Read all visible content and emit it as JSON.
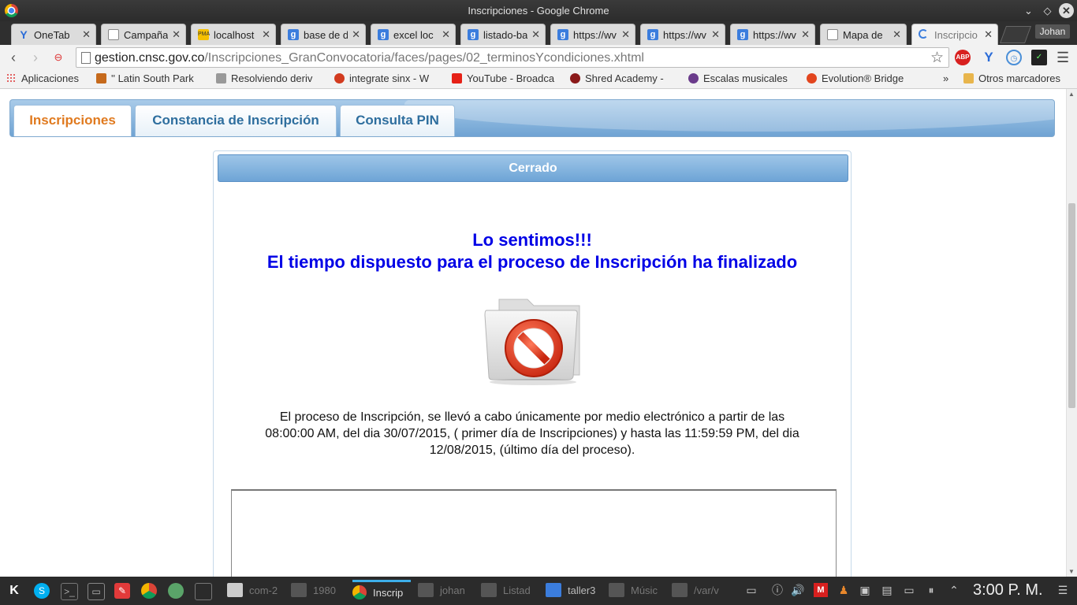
{
  "window": {
    "title": "Inscripciones - Google Chrome",
    "controls": [
      "minimize",
      "restore",
      "close"
    ]
  },
  "tabs": [
    {
      "label": "OneTab",
      "icon": "onetab-icon"
    },
    {
      "label": "Campaña",
      "icon": "document-icon"
    },
    {
      "label": "localhost",
      "icon": "phpmyadmin-icon"
    },
    {
      "label": "base de d",
      "icon": "google-icon"
    },
    {
      "label": "excel loc",
      "icon": "google-icon"
    },
    {
      "label": "listado-ba",
      "icon": "google-icon"
    },
    {
      "label": "https://wv",
      "icon": "google-icon"
    },
    {
      "label": "https://wv",
      "icon": "google-icon"
    },
    {
      "label": "https://wv",
      "icon": "google-icon"
    },
    {
      "label": "Mapa de",
      "icon": "document-icon"
    },
    {
      "label": "Inscripcio",
      "icon": "loading-icon",
      "active": true
    }
  ],
  "profile": {
    "name": "Johan"
  },
  "address_bar": {
    "host": "gestion.cnsc.gov.co",
    "path": "/Inscripciones_GranConvocatoria/faces/pages/02_terminosYcondiciones.xhtml"
  },
  "extensions": [
    "adblock-plus-icon",
    "yoroi-icon",
    "timer-icon",
    "todo-check-icon"
  ],
  "bookmarks": [
    {
      "label": "Aplicaciones",
      "icon": "apps-icon"
    },
    {
      "label": "'' Latin South Park",
      "icon": "bookmark-icon"
    },
    {
      "label": "Resolviendo deriv",
      "icon": "bookmark-icon"
    },
    {
      "label": "integrate sinx - W",
      "icon": "bookmark-icon"
    },
    {
      "label": "YouTube - Broadca",
      "icon": "youtube-icon"
    },
    {
      "label": "Shred Academy -",
      "icon": "bookmark-icon"
    },
    {
      "label": "Escalas musicales",
      "icon": "bookmark-icon"
    },
    {
      "label": "Evolution® Bridge",
      "icon": "bookmark-icon"
    },
    {
      "label": "»",
      "icon": ""
    },
    {
      "label": "Otros marcadores",
      "icon": "folder-icon"
    }
  ],
  "page": {
    "nav_tabs": [
      {
        "label": "Inscripciones",
        "active": true
      },
      {
        "label": "Constancia de Inscripción",
        "active": false
      },
      {
        "label": "Consulta PIN",
        "active": false
      }
    ],
    "panel_title": "Cerrado",
    "headline_1": "Lo sentimos!!!",
    "headline_2": "El tiempo dispuesto para el proceso de Inscripción ha finalizado",
    "body_line_1": "El proceso de Inscripción, se llevó a cabo únicamente por medio electrónico a partir de las",
    "body_line_2": "08:00:00 AM, del dia 30/07/2015, ( primer día de Inscripciones) y hasta las 11:59:59 PM, del dia",
    "body_line_3": "12/08/2015, (último día del proceso).",
    "image": "closed-folder-prohibited-icon"
  },
  "taskbar": {
    "tasks": [
      {
        "label": "com-2",
        "active": false
      },
      {
        "label": "1980",
        "active": false
      },
      {
        "label": "Inscrip",
        "active": true
      },
      {
        "label": "johan",
        "active": false
      },
      {
        "label": "Listad",
        "active": false
      },
      {
        "label": "taller3",
        "active": false
      },
      {
        "label": "Músic",
        "active": false
      },
      {
        "label": "/var/v",
        "active": false
      }
    ],
    "clock": "3:00 P. M."
  },
  "colors": {
    "headline": "#0000e6",
    "active_tab": "#e07a1f",
    "tab_text": "#2e6e9e",
    "panel_header": "#6ea4d6"
  }
}
